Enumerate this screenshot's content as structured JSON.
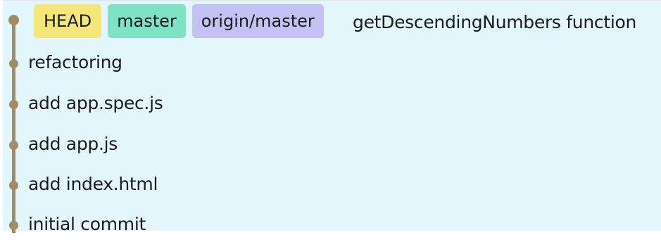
{
  "history": {
    "head_label": "HEAD",
    "local_branch": "master",
    "remote_branch": "origin/master",
    "commits": [
      "getDescendingNumbers function",
      "refactoring",
      "add app.spec.js",
      "add app.js",
      "add index.html",
      "initial commit"
    ]
  },
  "colors": {
    "graph_background": "#e3f6fb",
    "graph_line": "#a38b67",
    "head_badge": "#f4e678",
    "local_branch_badge": "#7fe3c3",
    "remote_branch_badge": "#c4c2f5"
  }
}
